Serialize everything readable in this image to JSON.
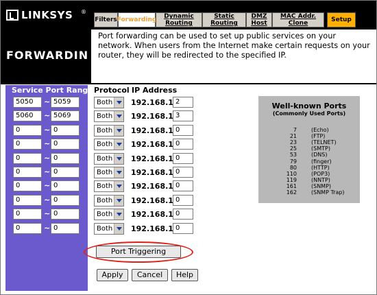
{
  "header": {
    "logo_text": "LINKSYS",
    "logo_mark": "®",
    "tabs": [
      {
        "label": "Filters"
      },
      {
        "label": "Forwarding"
      },
      {
        "label": "Dynamic Routing"
      },
      {
        "label": "Static Routing"
      },
      {
        "label": "DMZ Host"
      },
      {
        "label": "MAC Addr. Clone"
      },
      {
        "label": "Setup"
      }
    ],
    "active_tab": "Forwarding"
  },
  "page_title": "FORWARDING",
  "description": "Port forwarding can be used to set up public services on your network. When users from the Internet make certain requests on your router, they will be redirected to the specified IP.",
  "table": {
    "headers": {
      "port_range": "Service Port Range",
      "protocol": "Protocol",
      "ip": "IP Address"
    },
    "separator": "~",
    "ip_prefix": "192.168.1.",
    "rows": [
      {
        "start": "5050",
        "end": "5059",
        "protocol": "Both",
        "ip": "2"
      },
      {
        "start": "5060",
        "end": "5069",
        "protocol": "Both",
        "ip": "3"
      },
      {
        "start": "0",
        "end": "0",
        "protocol": "Both",
        "ip": "0"
      },
      {
        "start": "0",
        "end": "0",
        "protocol": "Both",
        "ip": "0"
      },
      {
        "start": "0",
        "end": "0",
        "protocol": "Both",
        "ip": "0"
      },
      {
        "start": "0",
        "end": "0",
        "protocol": "Both",
        "ip": "0"
      },
      {
        "start": "0",
        "end": "0",
        "protocol": "Both",
        "ip": "0"
      },
      {
        "start": "0",
        "end": "0",
        "protocol": "Both",
        "ip": "0"
      },
      {
        "start": "0",
        "end": "0",
        "protocol": "Both",
        "ip": "0"
      },
      {
        "start": "0",
        "end": "0",
        "protocol": "Both",
        "ip": "0"
      }
    ]
  },
  "well_known": {
    "title": "Well-known Ports",
    "subtitle": "(Commonly Used Ports)",
    "ports": [
      {
        "num": "7",
        "name": "(Echo)"
      },
      {
        "num": "21",
        "name": "(FTP)"
      },
      {
        "num": "23",
        "name": "(TELNET)"
      },
      {
        "num": "25",
        "name": "(SMTP)"
      },
      {
        "num": "53",
        "name": "(DNS)"
      },
      {
        "num": "79",
        "name": "(finger)"
      },
      {
        "num": "80",
        "name": "(HTTP)"
      },
      {
        "num": "110",
        "name": "(POP3)"
      },
      {
        "num": "119",
        "name": "(NNTP)"
      },
      {
        "num": "161",
        "name": "(SNMP)"
      },
      {
        "num": "162",
        "name": "(SNMP Trap)"
      }
    ]
  },
  "buttons": {
    "port_triggering": "Port Triggering",
    "apply": "Apply",
    "cancel": "Cancel",
    "help": "Help"
  },
  "colors": {
    "header_bg": "#000000",
    "left_panel": "#6a5acd",
    "active_tab_text": "#f0a030",
    "setup_tab": "#ffb000",
    "highlight_oval": "#e0201a"
  }
}
